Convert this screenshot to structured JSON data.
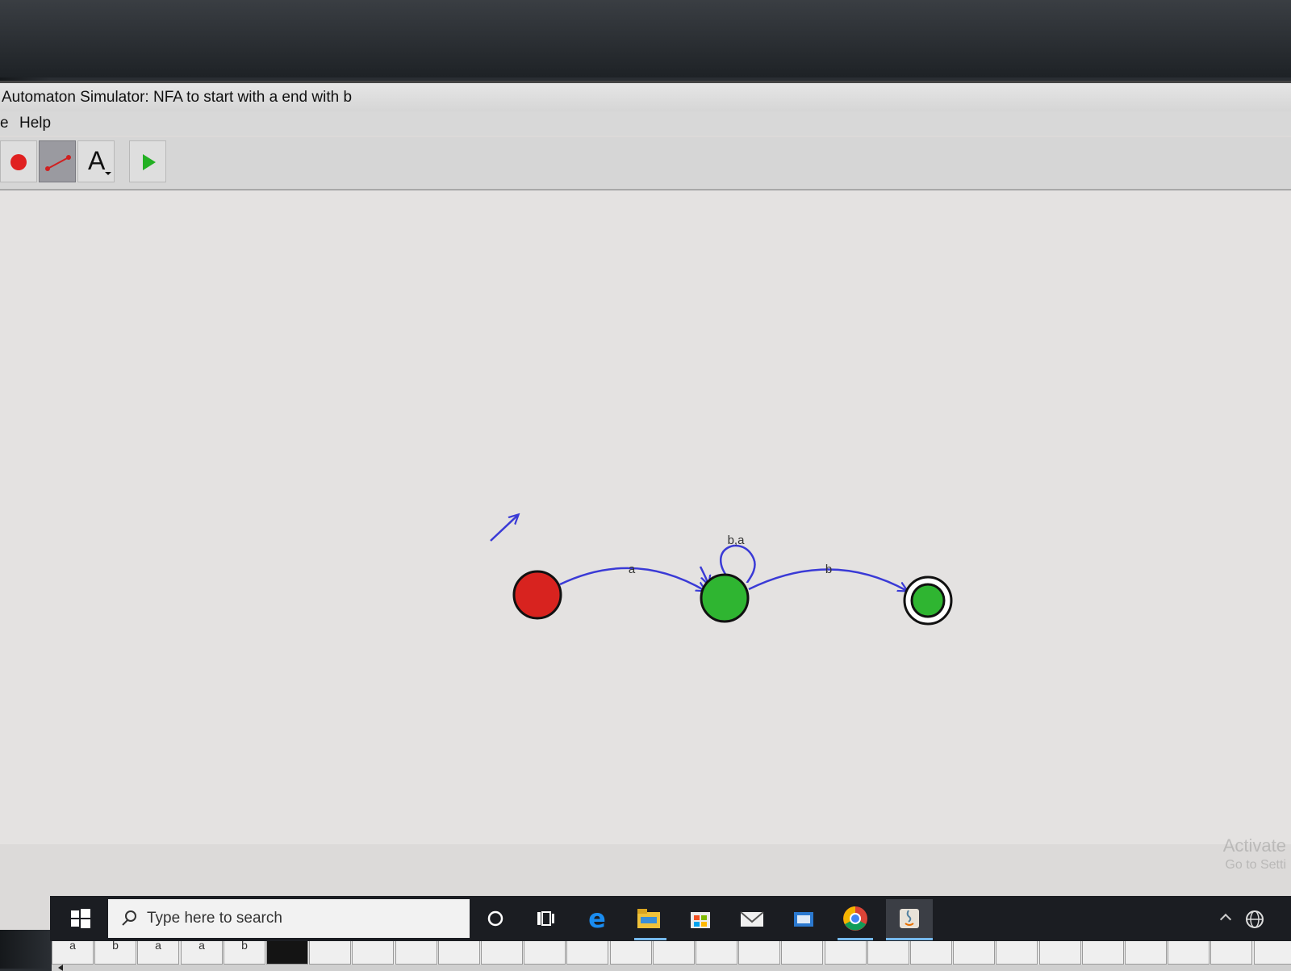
{
  "window": {
    "title": "Automaton Simulator: NFA to start with a end with b"
  },
  "menubar": {
    "items": [
      {
        "label": "e"
      },
      {
        "label": "Help"
      }
    ]
  },
  "toolbar": {
    "tools": [
      {
        "icon": "state-tool-icon",
        "selected": false
      },
      {
        "icon": "transition-tool-icon",
        "selected": true
      },
      {
        "icon": "text-tool-icon",
        "label": "A",
        "selected": false
      },
      {
        "icon": "play-icon",
        "selected": false
      }
    ]
  },
  "automaton": {
    "states": [
      {
        "id": "q0",
        "start": true,
        "final": false,
        "color": "#d8231f"
      },
      {
        "id": "q1",
        "start": false,
        "final": false,
        "color": "#2fb531"
      },
      {
        "id": "q2",
        "start": false,
        "final": true,
        "color": "#2fb531"
      }
    ],
    "transitions": [
      {
        "from": "q0",
        "to": "q1",
        "label": "a"
      },
      {
        "from": "q1",
        "to": "q1",
        "label": "b,a"
      },
      {
        "from": "q1",
        "to": "q2",
        "label": "b"
      }
    ],
    "edge_color": "#3a3ad6"
  },
  "tape": {
    "cells": [
      "a",
      "b",
      "a",
      "a",
      "b",
      "",
      "",
      "",
      "",
      "",
      "",
      "",
      "",
      "",
      "",
      "",
      "",
      "",
      "",
      "",
      "",
      "",
      "",
      "",
      "",
      "",
      "",
      "",
      "",
      ""
    ],
    "head_index": 5,
    "head_color": "#2fb531"
  },
  "taskbar": {
    "search_placeholder": "Type here to search",
    "icons": [
      "windows-start-icon",
      "cortana-icon",
      "task-view-icon",
      "edge-icon",
      "file-explorer-icon",
      "store-icon",
      "mail-icon",
      "app-icon",
      "chrome-icon",
      "java-icon"
    ]
  },
  "watermark": {
    "line1": "Activate",
    "line2": "Go to Setti"
  }
}
